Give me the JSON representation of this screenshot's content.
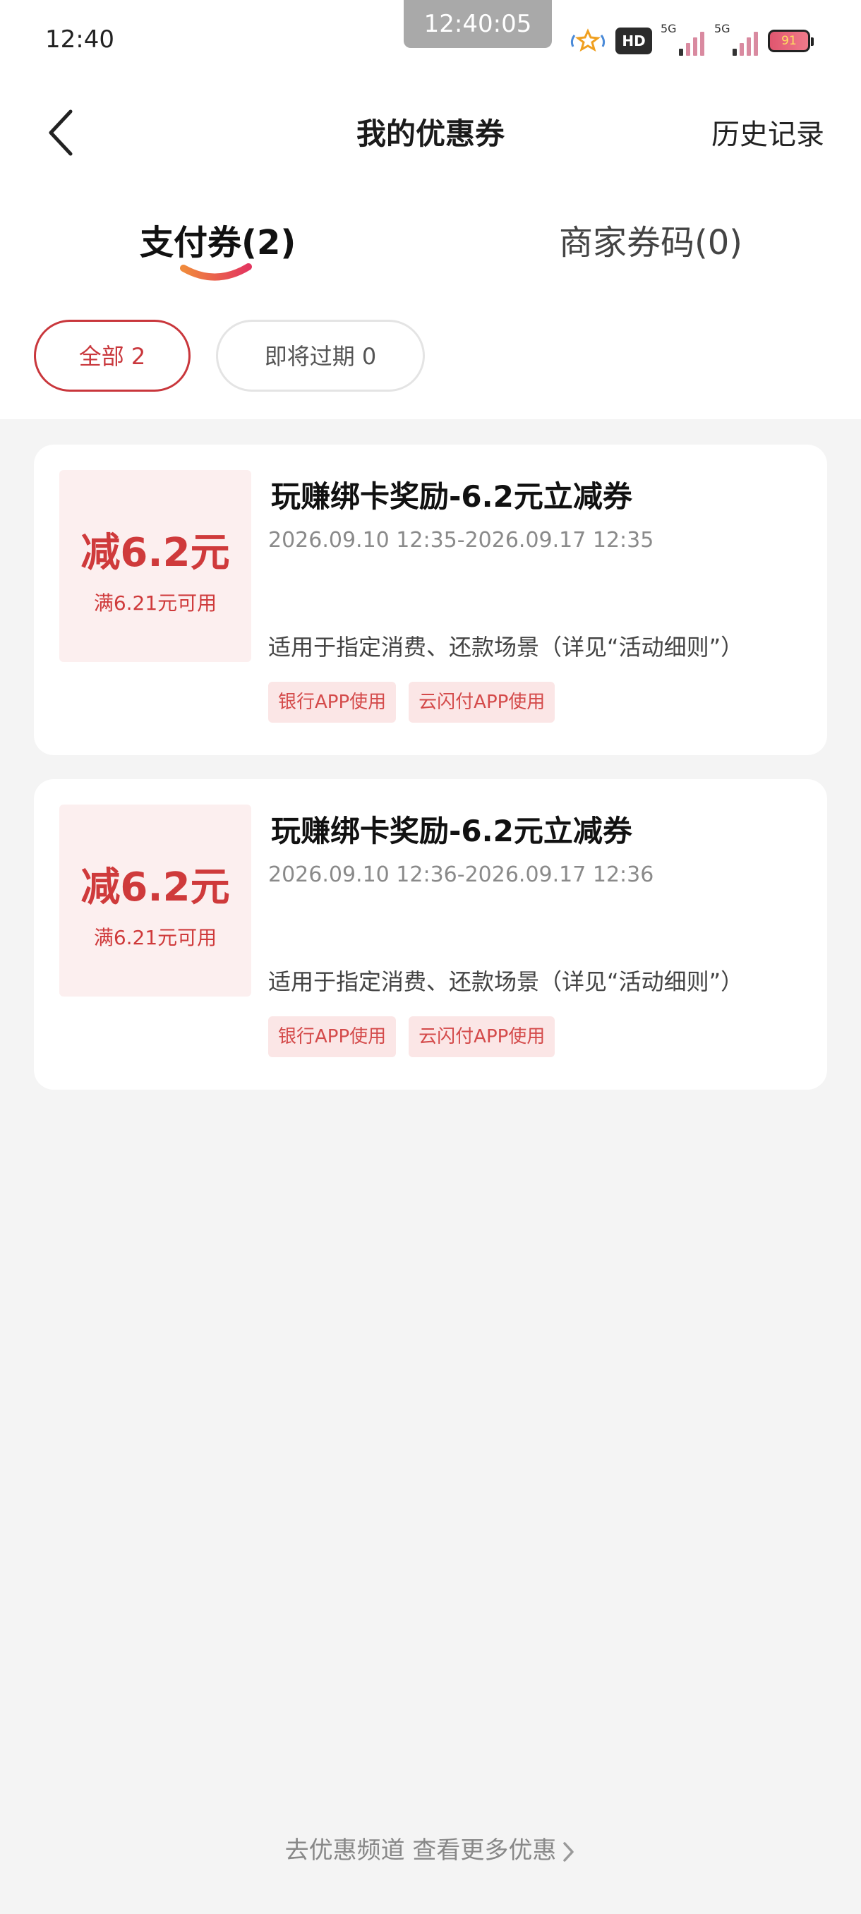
{
  "status_bar": {
    "time": "12:40",
    "clock_overlay": "12:40:05",
    "network_generation": "5G",
    "battery_level": "91",
    "icons": [
      "wifi-calling-icon",
      "hd-voice-icon",
      "signal-icon",
      "signal-icon",
      "battery-icon"
    ]
  },
  "header": {
    "title": "我的优惠券",
    "history_label": "历史记录"
  },
  "tabs": [
    {
      "label": "支付券(2)",
      "active": true
    },
    {
      "label": "商家券码(0)",
      "active": false
    }
  ],
  "filters": [
    {
      "label": "全部 2",
      "active": true
    },
    {
      "label": "即将过期 0",
      "active": false
    }
  ],
  "coupons": [
    {
      "amount": "减6.2元",
      "condition": "满6.21元可用",
      "title": "玩赚绑卡奖励-6.2元立减券",
      "period": "2026.09.10  12:35-2026.09.17  12:35",
      "description": "适用于指定消费、还款场景（详见“活动细则”）",
      "tags": [
        "银行APP使用",
        "云闪付APP使用"
      ]
    },
    {
      "amount": "减6.2元",
      "condition": "满6.21元可用",
      "title": "玩赚绑卡奖励-6.2元立减券",
      "period": "2026.09.10  12:36-2026.09.17  12:36",
      "description": "适用于指定消费、还款场景（详见“活动细则”）",
      "tags": [
        "银行APP使用",
        "云闪付APP使用"
      ]
    }
  ],
  "footer": {
    "link_label": "去优惠频道  查看更多优惠"
  },
  "colors": {
    "accent": "#c9373c",
    "coupon_bg": "#fcefef",
    "tag_bg": "#fbe6e6",
    "page_bg": "#f4f4f4"
  }
}
